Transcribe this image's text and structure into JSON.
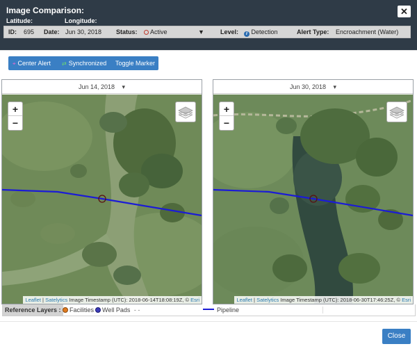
{
  "header": {
    "title": "Image Comparison:",
    "latitude_label": "Latitude:",
    "longitude_label": "Longitude:",
    "close_icon": "close-x-icon"
  },
  "info": {
    "id_label": "ID:",
    "id_value": "695",
    "date_label": "Date:",
    "date_value": "Jun 30, 2018",
    "status_label": "Status:",
    "status_value": "Active",
    "status_color": "#c0392b",
    "level_label": "Level:",
    "level_value": "Detection",
    "level_icon": "info-icon",
    "alert_type_label": "Alert Type:",
    "alert_type_value": "Encroachment (Water)"
  },
  "toolbar": {
    "center_alert": "Center Alert",
    "synchronized": "Synchronized",
    "toggle_marker": "Toggle Marker",
    "accent": "#3a7fc4"
  },
  "maps": {
    "left": {
      "date": "Jun 14, 2018",
      "zoom_in": "+",
      "zoom_out": "−",
      "attribution_leaflet": "Leaflet",
      "attribution_sep": "|",
      "attribution_satelytics": "Satelytics",
      "attribution_timestamp": "Image Timestamp (UTC): 2018-06-14T18:08:19Z, ©",
      "attribution_esri": "Esri"
    },
    "right": {
      "date": "Jun 30, 2018",
      "zoom_in": "+",
      "zoom_out": "−",
      "attribution_leaflet": "Leaflet",
      "attribution_sep": "|",
      "attribution_satelytics": "Satelytics",
      "attribution_timestamp": "Image Timestamp (UTC): 2018-06-30T17:46:25Z, ©",
      "attribution_esri": "Esri"
    },
    "pipeline_color": "#1b1bd6"
  },
  "reference_layers": {
    "label": "Reference Layers :",
    "facilities": "Facilities",
    "facilities_color": "#e07b1f",
    "well_pads": "Well Pads",
    "well_pads_color": "#3b3bb8",
    "well_pads_dash": "- -",
    "pipeline": "Pipeline"
  },
  "footer": {
    "close": "Close"
  }
}
